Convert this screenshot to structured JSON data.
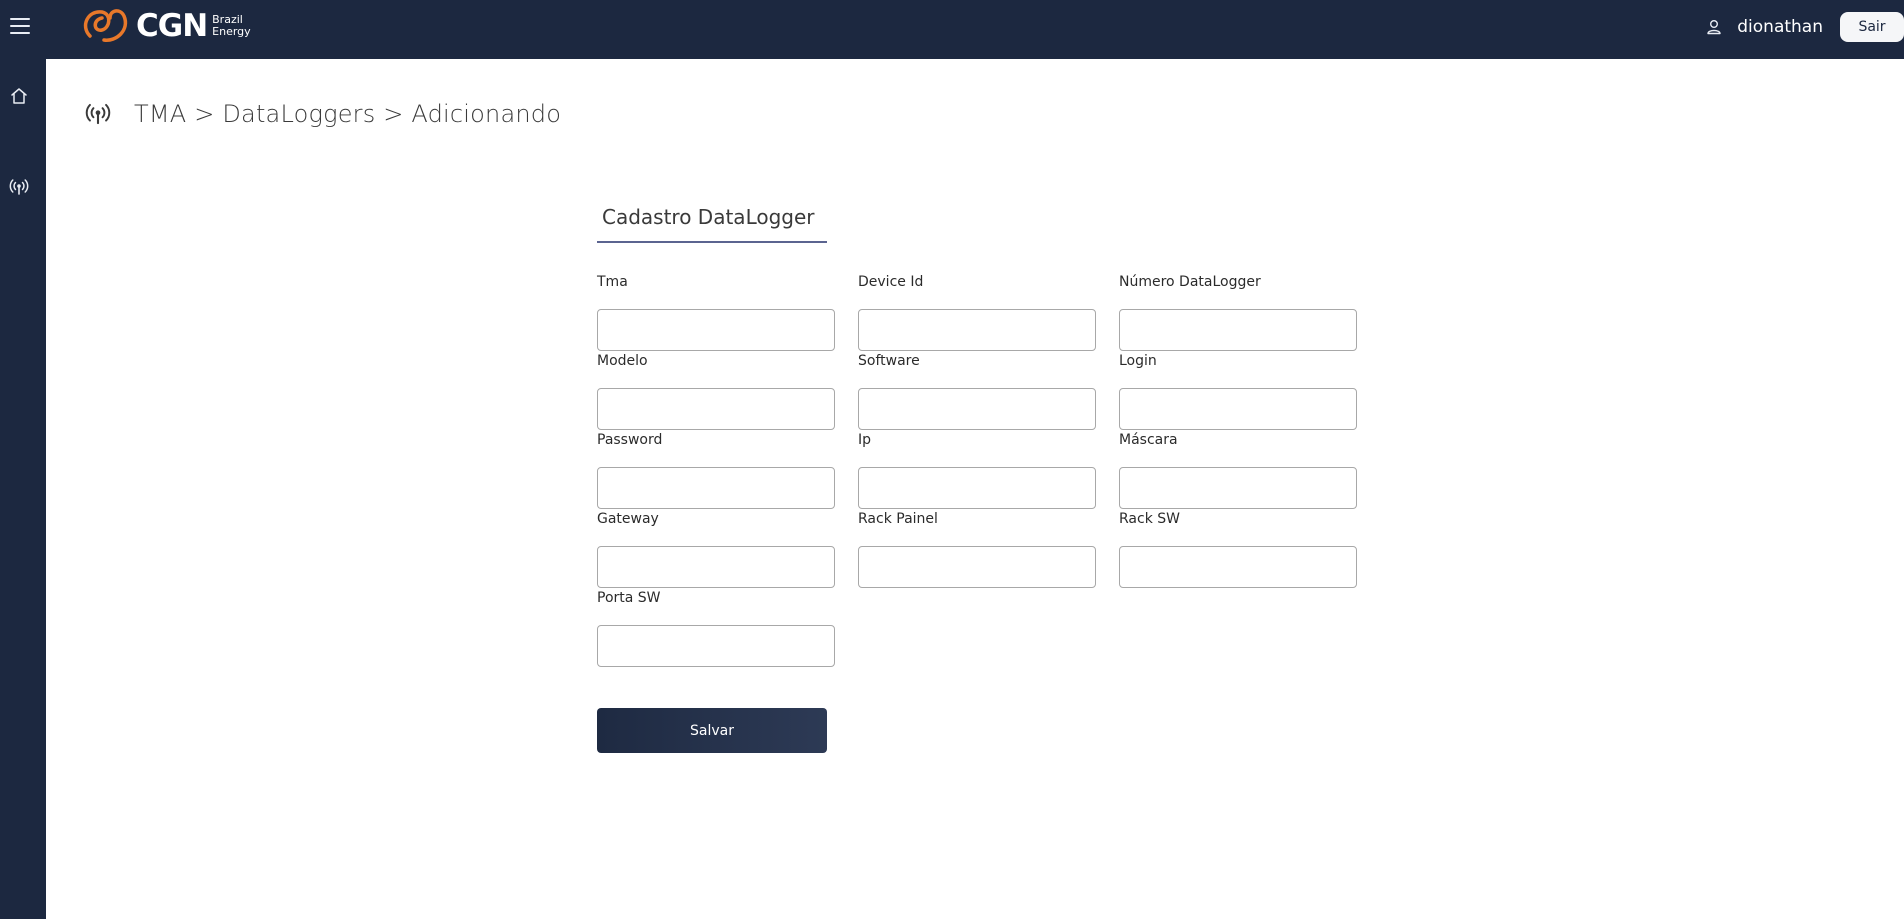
{
  "header": {
    "menu_icon": "hamburger-menu-icon",
    "logo_text": "CGN",
    "logo_sub1": "Brazil",
    "logo_sub2": "Energy",
    "user_icon": "user-icon",
    "username": "dionathan",
    "logout_label": "Sair"
  },
  "sidebar": {
    "items": [
      {
        "icon": "home-icon"
      },
      {
        "icon": "antenna-icon"
      }
    ]
  },
  "breadcrumb": {
    "icon": "antenna-icon",
    "text": "TMA > DataLoggers > Adicionando"
  },
  "form": {
    "title": "Cadastro DataLogger",
    "fields": [
      {
        "label": "Tma",
        "value": "",
        "placeholder": ""
      },
      {
        "label": "Device Id",
        "value": "",
        "placeholder": ""
      },
      {
        "label": "Número DataLogger",
        "value": "",
        "placeholder": ""
      },
      {
        "label": "Modelo",
        "value": "",
        "placeholder": ""
      },
      {
        "label": "Software",
        "value": "",
        "placeholder": ""
      },
      {
        "label": "Login",
        "value": "",
        "placeholder": ""
      },
      {
        "label": "Password",
        "value": "",
        "placeholder": ""
      },
      {
        "label": "Ip",
        "value": "",
        "placeholder": ""
      },
      {
        "label": "Máscara",
        "value": "",
        "placeholder": ""
      },
      {
        "label": "Gateway",
        "value": "",
        "placeholder": ""
      },
      {
        "label": "Rack Painel",
        "value": "",
        "placeholder": ""
      },
      {
        "label": "Rack SW",
        "value": "",
        "placeholder": ""
      },
      {
        "label": "Porta SW",
        "value": "",
        "placeholder": ""
      }
    ],
    "submit_label": "Salvar"
  },
  "colors": {
    "nav_bg": "#1c2840",
    "logo_orange": "#e8782a",
    "accent_underline": "#5b6490"
  }
}
